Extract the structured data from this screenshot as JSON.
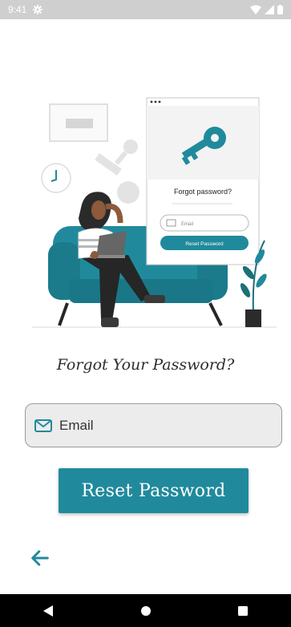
{
  "status_bar": {
    "time": "9:41",
    "icons": [
      "settings-icon",
      "wifi-icon",
      "signal-icon",
      "battery-icon"
    ]
  },
  "illustration": {
    "card_title": "Forgot password?",
    "card_email": "Email",
    "card_button": "Reset Password"
  },
  "page": {
    "title": "Forgot Your Password?"
  },
  "email_field": {
    "placeholder": "Email",
    "value": "",
    "icon": "mail-icon"
  },
  "reset_button": {
    "label": "Reset Password"
  },
  "back_button": {
    "icon": "arrow-left-icon"
  },
  "nav_bar": {
    "buttons": [
      "back-triangle-icon",
      "home-circle-icon",
      "recents-square-icon"
    ]
  },
  "colors": {
    "accent": "#208a9c",
    "status_bar": "#cfcfcf",
    "field_bg": "#ececec"
  }
}
